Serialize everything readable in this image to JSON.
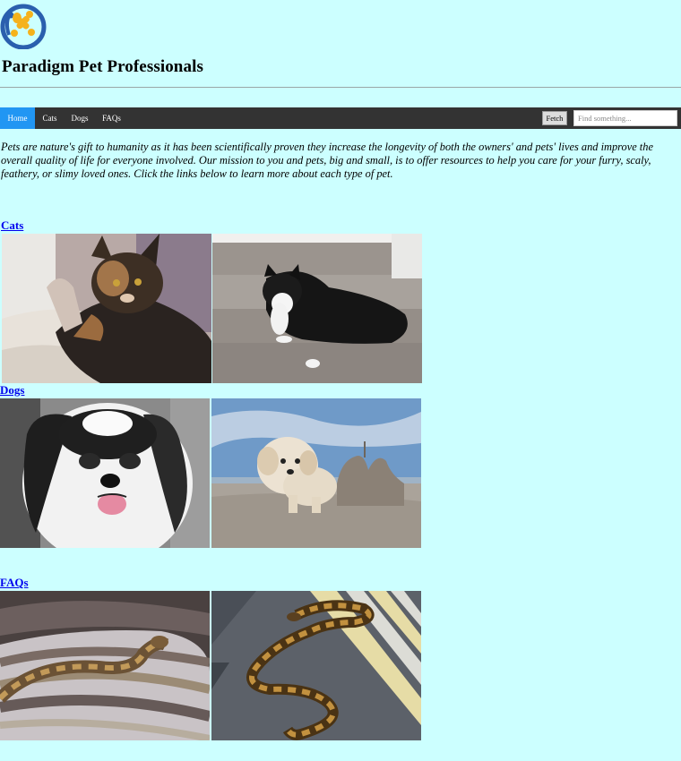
{
  "site": {
    "title": "Paradigm Pet Professionals",
    "logo_icon": "pet-logo-icon",
    "background_color": "#ccffff"
  },
  "nav": {
    "items": [
      {
        "label": "Home",
        "active": true
      },
      {
        "label": "Cats",
        "active": false
      },
      {
        "label": "Dogs",
        "active": false
      },
      {
        "label": "FAQs",
        "active": false
      }
    ],
    "fetch_label": "Fetch",
    "search_placeholder": "Find something...",
    "bar_color": "#333333",
    "active_color": "#2196F3"
  },
  "intro": {
    "text": "Pets are nature's gift to humanity as it has been scientifically proven they increase the longevity of both the owners' and pets' lives and improve the overall quality of life for everyone involved. Our mission to you and pets, big and small, is to offer resources to help you care for your furry, scaly, feathery, or slimy loved ones. Click the links below to learn more about each type of pet."
  },
  "sections": [
    {
      "heading": "Cats",
      "images": [
        "calico-cat-photo",
        "tuxedo-cat-on-stairs-photo"
      ]
    },
    {
      "heading": "Dogs",
      "images": [
        "shih-tzu-dog-photo",
        "white-dog-on-beach-photo"
      ]
    },
    {
      "heading": "FAQs",
      "images": [
        "ball-python-on-blanket-photo",
        "ball-python-on-striped-cloth-photo"
      ]
    }
  ]
}
